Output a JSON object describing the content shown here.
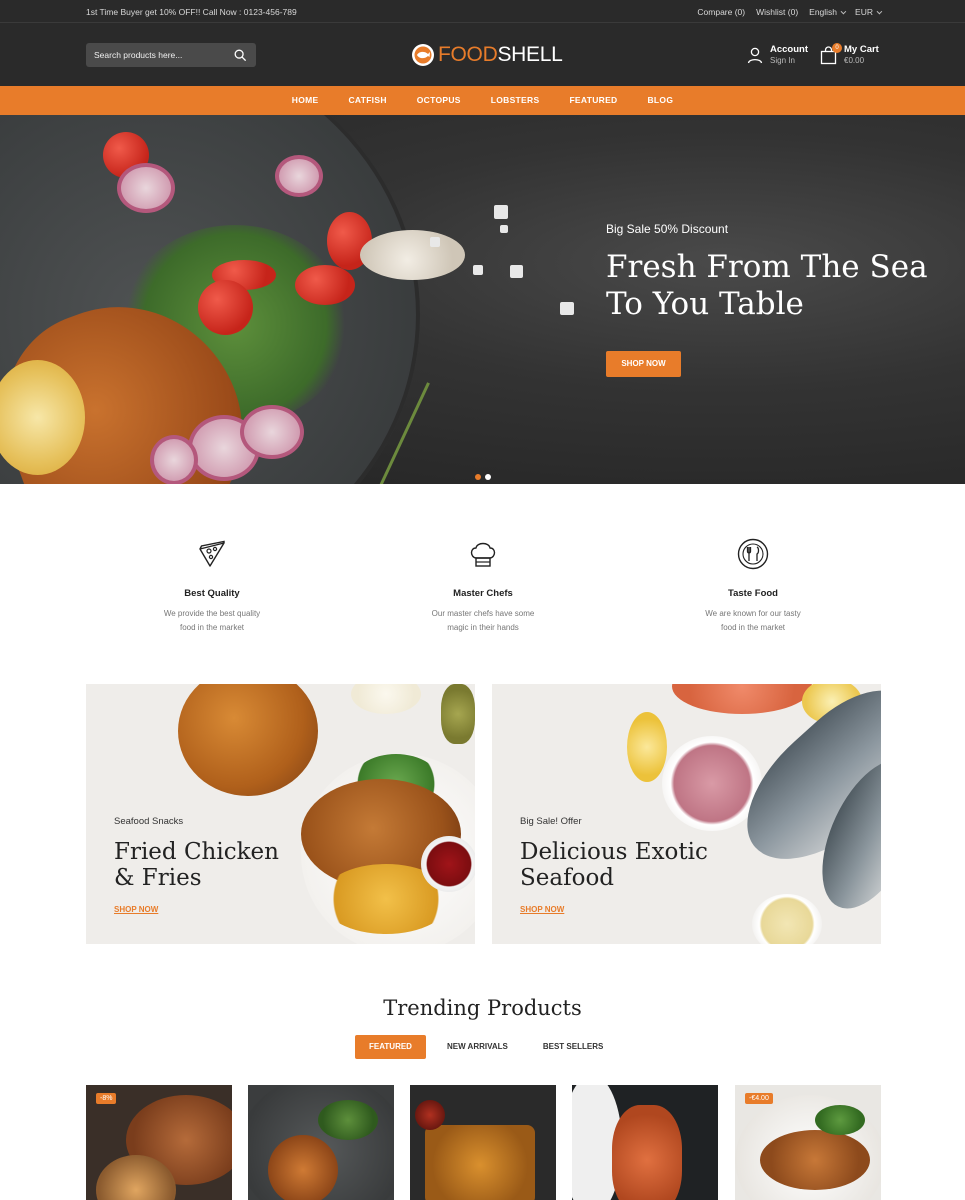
{
  "topbar": {
    "promo": "1st Time Buyer get 10% OFF!! Call Now : 0123-456-789",
    "compare": "Compare (0)",
    "wishlist": "Wishlist (0)",
    "language": "English",
    "currency": "EUR"
  },
  "header": {
    "search_placeholder": "Search products here...",
    "logo_part1": "FOOD",
    "logo_part2": "SHELL",
    "account_label": "Account",
    "account_sub": "Sign In",
    "cart_label": "My Cart",
    "cart_total": "€0.00",
    "cart_count": "0"
  },
  "nav": {
    "items": [
      "HOME",
      "CATFISH",
      "OCTOPUS",
      "LOBSTERS",
      "FEATURED",
      "BLOG"
    ]
  },
  "hero": {
    "eyebrow": "Big Sale 50% Discount",
    "title_line1": "Fresh From The Sea",
    "title_line2": "To You Table",
    "button": "SHOP NOW",
    "slides": 2,
    "active_slide": 1
  },
  "features": [
    {
      "title": "Best Quality",
      "desc_line1": "We provide the best quality",
      "desc_line2": "food in the market",
      "icon": "pizza-slice-icon"
    },
    {
      "title": "Master Chefs",
      "desc_line1": "Our master chefs have some",
      "desc_line2": "magic in their hands",
      "icon": "chef-hat-icon"
    },
    {
      "title": "Taste Food",
      "desc_line1": "We are known for our tasty",
      "desc_line2": "food in the market",
      "icon": "plate-cutlery-icon"
    }
  ],
  "banners": [
    {
      "eyebrow": "Seafood Snacks",
      "title_line1": "Fried Chicken",
      "title_line2": "& Fries",
      "link": "SHOP NOW"
    },
    {
      "eyebrow": "Big Sale! Offer",
      "title_line1": "Delicious Exotic",
      "title_line2": "Seafood",
      "link": "SHOP NOW"
    }
  ],
  "trending": {
    "title": "Trending Products",
    "tabs": [
      "FEATURED",
      "NEW ARRIVALS",
      "BEST SELLERS"
    ],
    "active_tab": 0,
    "products": [
      {
        "badge": "-8%"
      },
      {
        "badge": ""
      },
      {
        "badge": ""
      },
      {
        "badge": ""
      },
      {
        "badge": "-€4.00"
      }
    ]
  },
  "colors": {
    "accent": "#e87c2a",
    "dark": "#2a2a2a"
  }
}
